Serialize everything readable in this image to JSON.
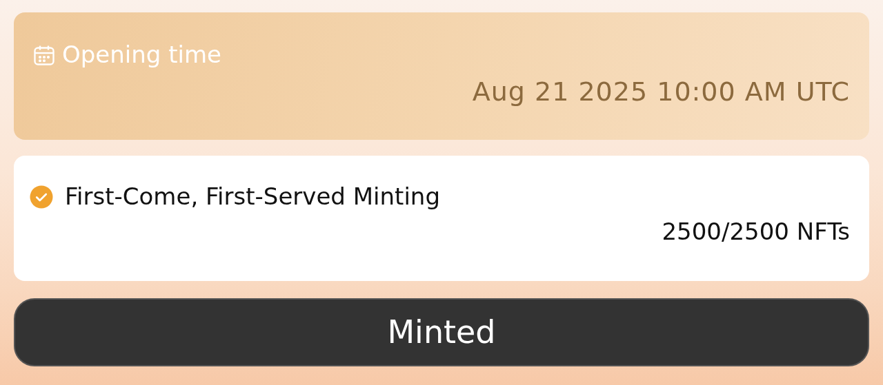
{
  "opening": {
    "label": "Opening time",
    "value": "Aug 21 2025 10:00 AM UTC"
  },
  "phase": {
    "title": "First-Come, First-Served Minting",
    "completed": true,
    "count": "2500/2500 NFTs"
  },
  "button": {
    "label": "Minted"
  }
}
